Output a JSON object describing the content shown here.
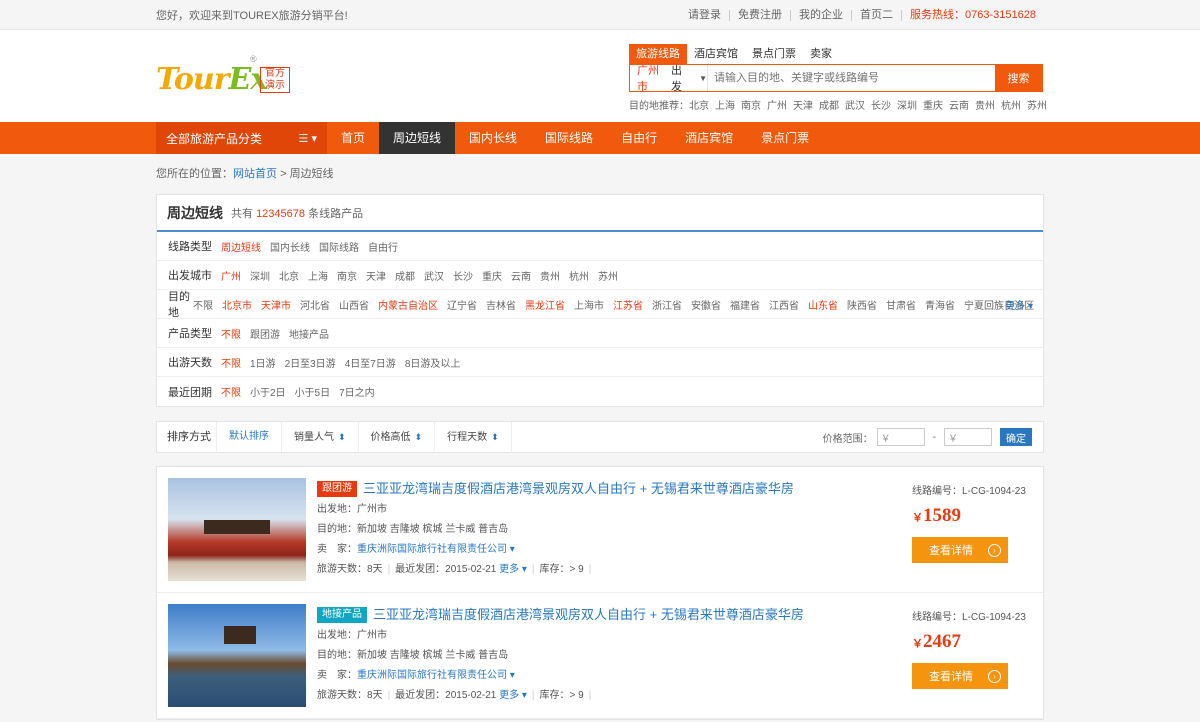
{
  "topbar": {
    "welcome": "您好，欢迎来到TOUREX旅游分销平台!",
    "links": [
      "请登录",
      "免费注册",
      "我的企业",
      "首页二"
    ],
    "hotline": "服务热线：0763-3151628"
  },
  "logo": {
    "part1": "Tour",
    "part2": "Ex",
    "reg": "®",
    "badge1": "官方",
    "badge2": "演示"
  },
  "search": {
    "tabs": [
      "旅游线路",
      "酒店宾馆",
      "景点门票",
      "卖家"
    ],
    "city": "广州市",
    "depart": "出发",
    "placeholder": "请输入目的地、关键字或线路编号",
    "button": "搜索",
    "hot_label": "目的地推荐：",
    "hot": [
      "北京",
      "上海",
      "南京",
      "广州",
      "天津",
      "成都",
      "武汉",
      "长沙",
      "深圳",
      "重庆",
      "云南",
      "贵州",
      "杭州",
      "苏州"
    ]
  },
  "nav": {
    "category": "全部旅游产品分类",
    "items": [
      "首页",
      "周边短线",
      "国内长线",
      "国际线路",
      "自由行",
      "酒店宾馆",
      "景点门票"
    ]
  },
  "breadcrumb": {
    "prefix": "您所在的位置：",
    "home": "网站首页",
    "sep": ">",
    "current": "周边短线"
  },
  "filter": {
    "title": "周边短线",
    "count_prefix": "共有",
    "count": "12345678",
    "count_suffix": "条线路产品",
    "rows": [
      {
        "label": "线路类型",
        "options": [
          "周边短线",
          "国内长线",
          "国际线路",
          "自由行"
        ],
        "selected": [
          0
        ]
      },
      {
        "label": "出发城市",
        "options": [
          "广州",
          "深圳",
          "北京",
          "上海",
          "南京",
          "天津",
          "成都",
          "武汉",
          "长沙",
          "重庆",
          "云南",
          "贵州",
          "杭州",
          "苏州"
        ],
        "selected": [
          0
        ]
      },
      {
        "label": "目的地",
        "options": [
          "不限",
          "北京市",
          "天津市",
          "河北省",
          "山西省",
          "内蒙古自治区",
          "辽宁省",
          "吉林省",
          "黑龙江省",
          "上海市",
          "江苏省",
          "浙江省",
          "安徽省",
          "福建省",
          "江西省",
          "山东省",
          "陕西省",
          "甘肃省",
          "青海省",
          "宁夏回族自治区"
        ],
        "selected": [
          1,
          2,
          5,
          8,
          10,
          15
        ],
        "more": "更多"
      },
      {
        "label": "产品类型",
        "options": [
          "不限",
          "跟团游",
          "地接产品"
        ],
        "selected": [
          0
        ]
      },
      {
        "label": "出游天数",
        "options": [
          "不限",
          "1日游",
          "2日至3日游",
          "4日至7日游",
          "8日游及以上"
        ],
        "selected": [
          0
        ]
      },
      {
        "label": "最近团期",
        "options": [
          "不限",
          "小于2日",
          "小于5日",
          "7日之内"
        ],
        "selected": [
          0
        ]
      }
    ]
  },
  "sort": {
    "label": "排序方式",
    "items": [
      "默认排序",
      "销量人气",
      "价格高低",
      "行程天数"
    ],
    "price_label": "价格范围：",
    "yen": "￥",
    "dash": "-",
    "confirm": "确定"
  },
  "products": [
    {
      "tag": "跟团游",
      "tag_color": "#e83a10",
      "title": "三亚亚龙湾瑞吉度假酒店港湾景观房双人自由行 + 无锡君来世尊酒店豪华房",
      "depart": "出发地：广州市",
      "dest": "目的地：新加坡 吉隆坡 槟城 兰卡威 普吉岛",
      "seller_label": "卖　家：",
      "seller": "重庆洲际国际旅行社有限责任公司",
      "days": "旅游天数：8天",
      "recent": "最近发团：2015-02-21",
      "more": "更多",
      "stock": "库存：> 9",
      "code": "线路编号：L-CG-1094-23",
      "price_symbol": "￥",
      "price": "1589",
      "button": "查看详情"
    },
    {
      "tag": "地接产品",
      "tag_color": "#12a5c4",
      "title": "三亚亚龙湾瑞吉度假酒店港湾景观房双人自由行 + 无锡君来世尊酒店豪华房",
      "depart": "出发地：广州市",
      "dest": "目的地：新加坡 吉隆坡 槟城 兰卡威 普吉岛",
      "seller_label": "卖　家：",
      "seller": "重庆洲际国际旅行社有限责任公司",
      "days": "旅游天数：8天",
      "recent": "最近发团：2015-02-21",
      "more": "更多",
      "stock": "库存：> 9",
      "code": "线路编号：L-CG-1094-23",
      "price_symbol": "￥",
      "price": "2467",
      "button": "查看详情"
    }
  ],
  "colors": {
    "accent": "#f15a0c",
    "link": "#2a78c2",
    "price": "#e83a10",
    "button": "#f5950f"
  }
}
